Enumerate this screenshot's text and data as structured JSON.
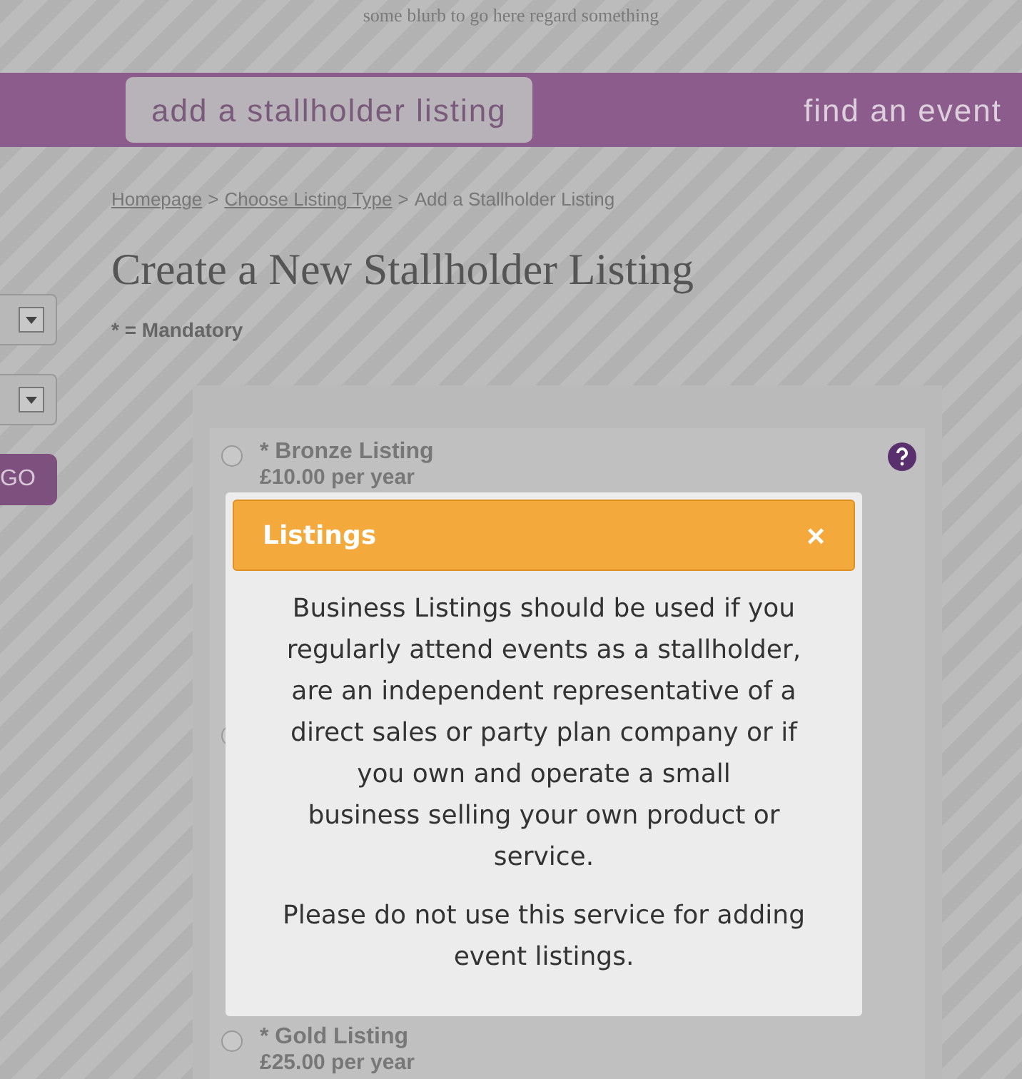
{
  "blurb": "some blurb to go here regard something",
  "nav": [
    {
      "label": "add a stallholder listing",
      "selected": true
    },
    {
      "label": "find an event",
      "selected": false
    }
  ],
  "sidebar": {
    "selects": [
      {
        "kind": "select"
      },
      {
        "kind": "select"
      }
    ],
    "go_button": "GO"
  },
  "breadcrumb": [
    {
      "label": "Homepage",
      "link": true
    },
    {
      "label": ">",
      "link": false
    },
    {
      "label": "Choose Listing Type",
      "link": true
    },
    {
      "label": ">",
      "link": false
    },
    {
      "label": "Add a Stallholder Listing",
      "link": false
    }
  ],
  "title": "Create a New Stallholder Listing",
  "mandatory_note": "* = Mandatory",
  "listing_options": [
    {
      "label": "* Bronze Listing",
      "price": "£10.00 per year",
      "selected": false,
      "help": true
    },
    {
      "selected": false
    },
    {
      "label": "* Gold Listing",
      "price": "£25.00 per year",
      "selected": false
    }
  ],
  "dialog": {
    "title": "Listings",
    "close": "×",
    "paragraphs": [
      "Business Listings should be used if you\nregularly attend events as a stallholder,\nare an independent representative of a\ndirect sales or party plan company or if\nyou own and operate a small\nbusiness selling your own product or\nservice.",
      "Please do not use this service for adding\nevent listings."
    ]
  }
}
